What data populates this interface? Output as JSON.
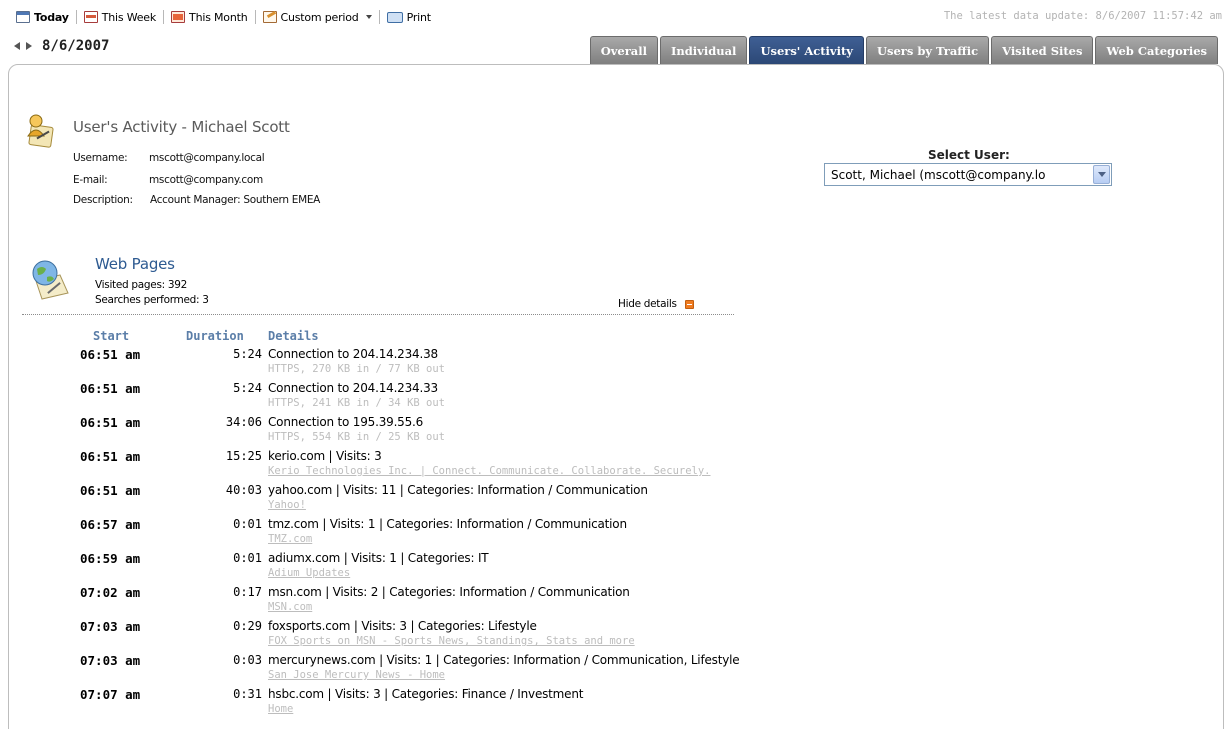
{
  "toolbar": {
    "today": "Today",
    "this_week": "This Week",
    "this_month": "This Month",
    "custom_period": "Custom period",
    "print": "Print"
  },
  "last_update": "The latest data update: 8/6/2007 11:57:42 am",
  "date": "8/6/2007",
  "tabs": [
    {
      "label": "Overall",
      "active": false
    },
    {
      "label": "Individual",
      "active": false
    },
    {
      "label": "Users' Activity",
      "active": true
    },
    {
      "label": "Users by Traffic",
      "active": false
    },
    {
      "label": "Visited Sites",
      "active": false
    },
    {
      "label": "Web Categories",
      "active": false
    }
  ],
  "user": {
    "title": "User's Activity - Michael Scott",
    "username_label": "Username:",
    "username": "mscott@company.local",
    "email_label": "E-mail:",
    "email": "mscott@company.com",
    "description_label": "Description:",
    "description": "Account Manager: Southern EMEA"
  },
  "select_user": {
    "label": "Select User:",
    "value": "Scott, Michael (mscott@company.lo"
  },
  "web_pages": {
    "title": "Web Pages",
    "visited": "Visited pages: 392",
    "searches": "Searches performed: 3",
    "hide_details": "Hide details"
  },
  "table": {
    "headers": {
      "start": "Start",
      "duration": "Duration",
      "details": "Details"
    },
    "rows": [
      {
        "start": "06:51 am",
        "duration": "5:24",
        "main": "Connection to 204.14.234.38",
        "sub": "HTTPS, 270 KB in / 77 KB out",
        "link": false
      },
      {
        "start": "06:51 am",
        "duration": "5:24",
        "main": "Connection to 204.14.234.33",
        "sub": "HTTPS, 241 KB in / 34 KB out",
        "link": false
      },
      {
        "start": "06:51 am",
        "duration": "34:06",
        "main": "Connection to 195.39.55.6",
        "sub": "HTTPS, 554 KB in / 25 KB out",
        "link": false
      },
      {
        "start": "06:51 am",
        "duration": "15:25",
        "main": "kerio.com | Visits: 3",
        "sub": "Kerio Technologies Inc. | Connect. Communicate. Collaborate. Securely.",
        "link": true
      },
      {
        "start": "06:51 am",
        "duration": "40:03",
        "main": "yahoo.com | Visits: 11 | Categories: Information / Communication",
        "sub": "Yahoo!",
        "link": true
      },
      {
        "start": "06:57 am",
        "duration": "0:01",
        "main": "tmz.com | Visits: 1 | Categories: Information / Communication",
        "sub": "TMZ.com",
        "link": true
      },
      {
        "start": "06:59 am",
        "duration": "0:01",
        "main": "adiumx.com | Visits: 1 | Categories: IT",
        "sub": "Adium Updates",
        "link": true
      },
      {
        "start": "07:02 am",
        "duration": "0:17",
        "main": "msn.com | Visits: 2 | Categories: Information / Communication",
        "sub": "MSN.com",
        "link": true
      },
      {
        "start": "07:03 am",
        "duration": "0:29",
        "main": "foxsports.com | Visits: 3 | Categories: Lifestyle",
        "sub": "FOX Sports on MSN - Sports News, Standings, Stats and more",
        "link": true
      },
      {
        "start": "07:03 am",
        "duration": "0:03",
        "main": "mercurynews.com | Visits: 1 | Categories: Information / Communication, Lifestyle",
        "sub": "San Jose Mercury News - Home",
        "link": true
      },
      {
        "start": "07:07 am",
        "duration": "0:31",
        "main": "hsbc.com | Visits: 3 | Categories: Finance / Investment",
        "sub": "Home",
        "link": true
      }
    ]
  },
  "colors": {
    "active_tab": "#2c4876",
    "inactive_tab": "#8c8c8c",
    "header_blue": "#5b7ea8",
    "title_blue": "#2d5a91",
    "muted_text": "#bdbdbd"
  },
  "icons": [
    "calendar-today-icon",
    "calendar-week-icon",
    "calendar-month-icon",
    "custom-period-icon",
    "printer-icon",
    "user-icon",
    "globe-document-icon",
    "collapse-icon",
    "prev-arrow-icon",
    "next-arrow-icon",
    "dropdown-arrow-icon"
  ]
}
